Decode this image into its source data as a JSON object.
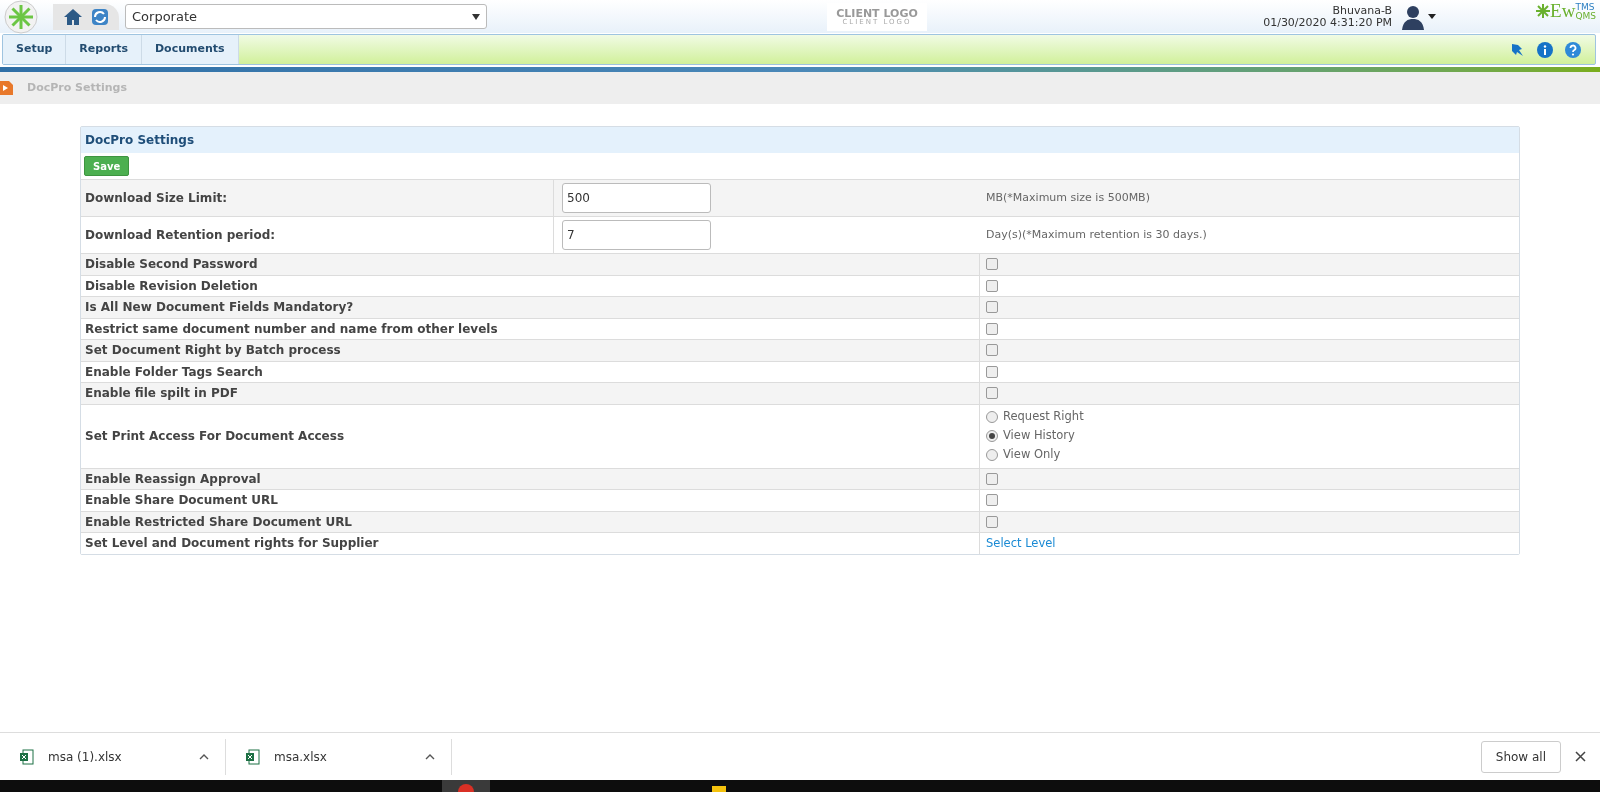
{
  "header": {
    "org_select": "Corporate",
    "client_logo": "CLIENT LOGO",
    "client_logo_sub": "CLIENT LOGO",
    "user": "Bhuvana-B",
    "datetime": "01/30/2020 4:31:20 PM",
    "brand": "Ew",
    "brand_top": "TMS",
    "brand_bottom": "QMS"
  },
  "menu": [
    {
      "label": "Setup"
    },
    {
      "label": "Reports"
    },
    {
      "label": "Documents"
    }
  ],
  "breadcrumb": "DocPro Settings",
  "panel": {
    "title": "DocPro Settings",
    "save_button": "Save",
    "settings": [
      {
        "kind": "input",
        "label": "Download Size Limit:",
        "value": "500",
        "note": "MB(*Maximum size is 500MB)"
      },
      {
        "kind": "input",
        "label": "Download Retention period:",
        "value": "7",
        "note": "Day(s)(*Maximum retention is 30 days.)"
      },
      {
        "kind": "checkbox",
        "label": "Disable Second Password",
        "checked": false
      },
      {
        "kind": "checkbox",
        "label": "Disable Revision Deletion",
        "checked": false
      },
      {
        "kind": "checkbox",
        "label": "Is All New Document Fields Mandatory?",
        "checked": false
      },
      {
        "kind": "checkbox",
        "label": "Restrict same document number and name from other levels",
        "checked": false
      },
      {
        "kind": "checkbox",
        "label": "Set Document Right by Batch process",
        "checked": false
      },
      {
        "kind": "checkbox",
        "label": "Enable Folder Tags Search",
        "checked": false
      },
      {
        "kind": "checkbox",
        "label": "Enable file spilt in PDF",
        "checked": false
      },
      {
        "kind": "radio",
        "label": "Set Print Access For Document Access",
        "options": [
          {
            "label": "Request Right",
            "selected": false
          },
          {
            "label": "View History",
            "selected": true
          },
          {
            "label": "View Only",
            "selected": false
          }
        ]
      },
      {
        "kind": "checkbox",
        "label": "Enable Reassign Approval",
        "checked": false
      },
      {
        "kind": "checkbox",
        "label": "Enable Share Document URL",
        "checked": false
      },
      {
        "kind": "checkbox",
        "label": "Enable Restricted Share Document URL",
        "checked": false
      },
      {
        "kind": "link",
        "label": "Set Level and Document rights for Supplier",
        "link": "Select Level"
      }
    ]
  },
  "downloads": [
    {
      "name": "msa (1).xlsx"
    },
    {
      "name": "msa.xlsx"
    }
  ],
  "show_all": "Show all"
}
